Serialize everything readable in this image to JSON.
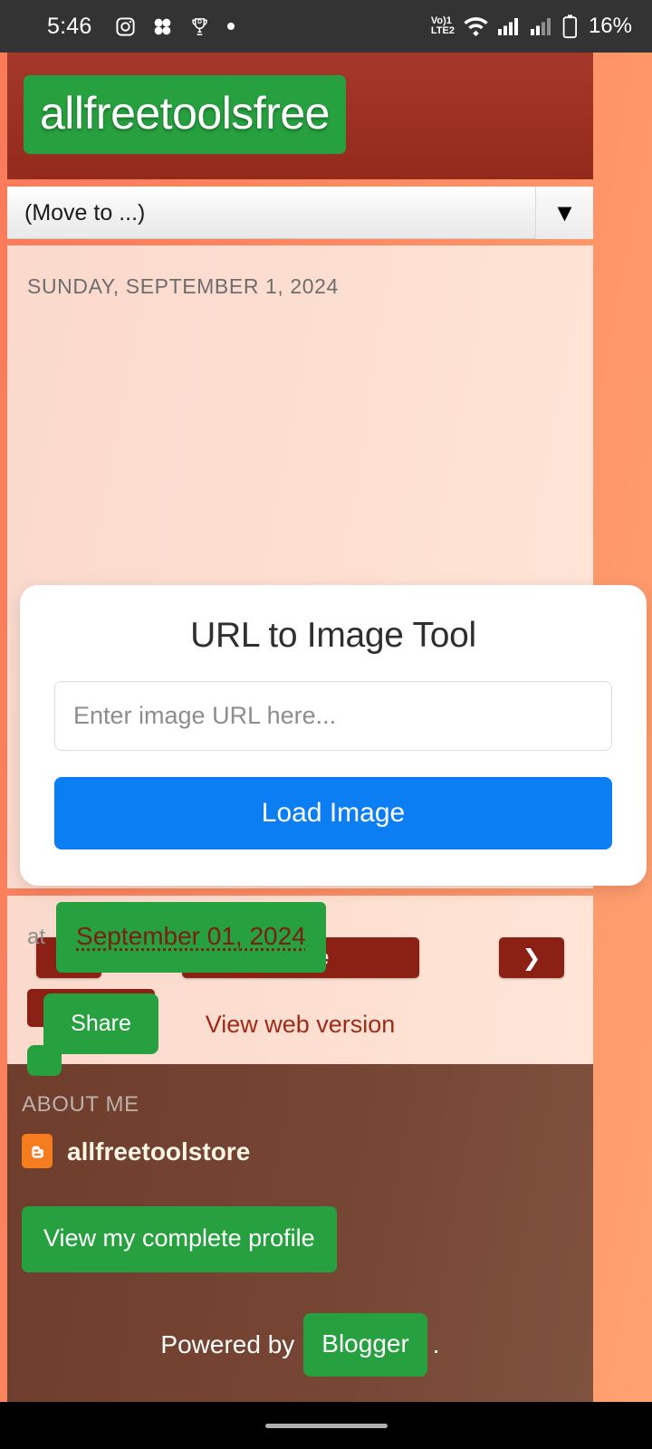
{
  "statusbar": {
    "time": "5:46",
    "icons": [
      "instagram-icon",
      "clover-icon",
      "trophy-icon",
      "dot-icon"
    ],
    "network_line1": "Vo)1",
    "network_line2": "LTE2",
    "battery": "16%"
  },
  "blog": {
    "title": "allfreetoolsfree",
    "move_to_label": "(Move to ...)",
    "move_to_arrow": "▼"
  },
  "post": {
    "date": "SUNDAY, SEPTEMBER 1, 2024",
    "timestamp_prefix": "at",
    "timestamp": "September 01, 2024",
    "share_label": "Share"
  },
  "tool": {
    "title": "URL to Image Tool",
    "url_placeholder": "Enter image URL here...",
    "url_value": "",
    "load_button": "Load Image"
  },
  "nav": {
    "prev": "❮",
    "home": "Home",
    "next": "❯",
    "web_version": "View web version"
  },
  "about": {
    "heading": "ABOUT ME",
    "username": "allfreetoolstore",
    "profile_button": "View my complete profile"
  },
  "footer": {
    "powered_by": "Powered by",
    "blogger": "Blogger",
    "period": "."
  },
  "colors": {
    "header_red": "#942a1c",
    "accent_green": "#27a03f",
    "button_blue": "#0b7ef4",
    "page_orange": "#fd8a62",
    "content_peach": "#fde0d2",
    "about_brown": "#764534",
    "link_red": "#9e2b17"
  }
}
